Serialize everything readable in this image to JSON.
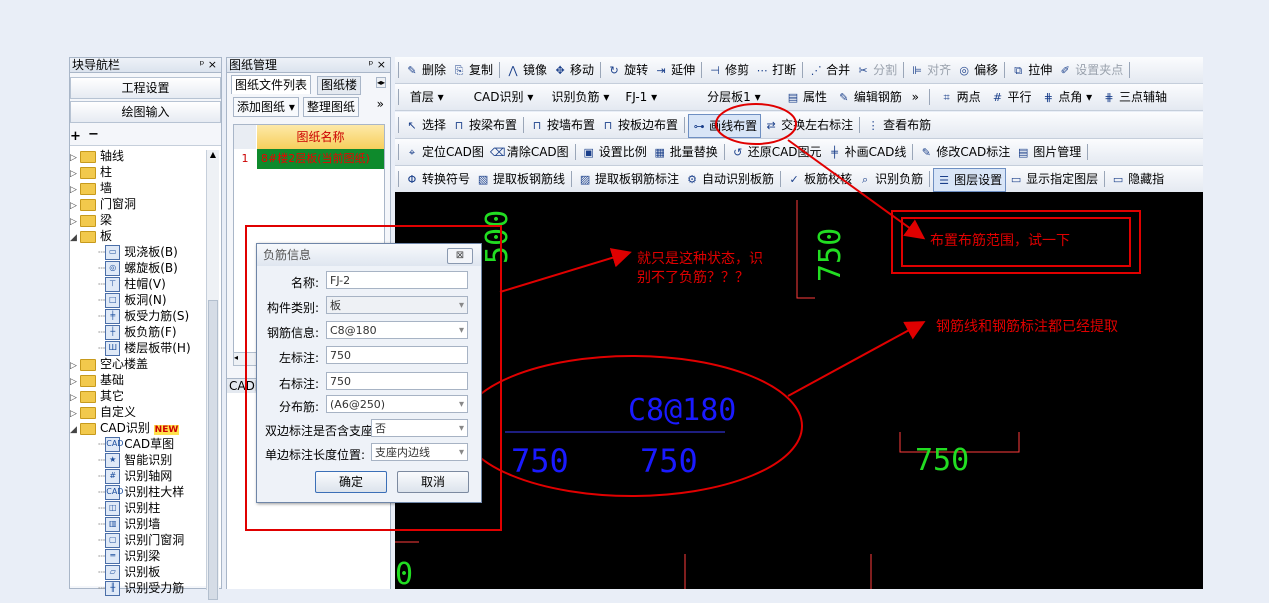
{
  "nav_panel": {
    "title": "块导航栏",
    "pin": "ᵖ",
    "close": "×",
    "buttons": [
      "工程设置",
      "绘图输入"
    ],
    "tree": [
      {
        "label": "轴线",
        "level": 0,
        "icon": "folder-icon"
      },
      {
        "label": "柱",
        "level": 0,
        "icon": "folder-icon"
      },
      {
        "label": "墙",
        "level": 0,
        "icon": "folder-icon"
      },
      {
        "label": "门窗洞",
        "level": 0,
        "icon": "folder-icon"
      },
      {
        "label": "梁",
        "level": 0,
        "icon": "folder-icon"
      },
      {
        "label": "板",
        "level": 0,
        "icon": "folder-open-icon"
      },
      {
        "label": "现浇板(B)",
        "level": 1,
        "icon": "slab-icon"
      },
      {
        "label": "螺旋板(B)",
        "level": 1,
        "icon": "spiral-slab-icon"
      },
      {
        "label": "柱帽(V)",
        "level": 1,
        "icon": "column-cap-icon"
      },
      {
        "label": "板洞(N)",
        "level": 1,
        "icon": "slab-hole-icon"
      },
      {
        "label": "板受力筋(S)",
        "level": 1,
        "icon": "slab-rebar-icon"
      },
      {
        "label": "板负筋(F)",
        "level": 1,
        "icon": "negative-rebar-icon"
      },
      {
        "label": "楼层板带(H)",
        "level": 1,
        "icon": "floor-strip-icon"
      },
      {
        "label": "空心楼盖",
        "level": 0,
        "icon": "folder-icon"
      },
      {
        "label": "基础",
        "level": 0,
        "icon": "folder-icon"
      },
      {
        "label": "其它",
        "level": 0,
        "icon": "folder-icon"
      },
      {
        "label": "自定义",
        "level": 0,
        "icon": "folder-icon"
      },
      {
        "label": "CAD识别",
        "level": 0,
        "icon": "folder-open-icon",
        "badge": "NEW"
      },
      {
        "label": "CAD草图",
        "level": 1,
        "icon": "cad-sketch-icon"
      },
      {
        "label": "智能识别",
        "level": 1,
        "icon": "smart-recognize-icon"
      },
      {
        "label": "识别轴网",
        "level": 1,
        "icon": "grid-recognize-icon"
      },
      {
        "label": "识别柱大样",
        "level": 1,
        "icon": "column-detail-icon"
      },
      {
        "label": "识别柱",
        "level": 1,
        "icon": "column-recognize-icon"
      },
      {
        "label": "识别墙",
        "level": 1,
        "icon": "wall-recognize-icon"
      },
      {
        "label": "识别门窗洞",
        "level": 1,
        "icon": "opening-recognize-icon"
      },
      {
        "label": "识别梁",
        "level": 1,
        "icon": "beam-recognize-icon"
      },
      {
        "label": "识别板",
        "level": 1,
        "icon": "slab-recognize-icon"
      },
      {
        "label": "识别受力筋",
        "level": 1,
        "icon": "rebar-recognize-icon"
      }
    ]
  },
  "drawing_panel": {
    "title": "图纸管理",
    "tabs": [
      "图纸文件列表",
      "图纸楼"
    ],
    "add_button": "添加图纸",
    "organize_button": "整理图纸",
    "more": "»",
    "column_header": "图纸名称",
    "rows": [
      {
        "index": "1",
        "name": "8#楼2层板(当前图纸)"
      }
    ],
    "cad_title": "CAD图"
  },
  "toolbar1": [
    {
      "label": "删除",
      "icon": "delete-icon"
    },
    {
      "label": "复制",
      "icon": "copy-icon"
    },
    {
      "label": "镜像",
      "icon": "mirror-icon"
    },
    {
      "label": "移动",
      "icon": "move-icon"
    },
    {
      "label": "旋转",
      "icon": "rotate-icon"
    },
    {
      "label": "延伸",
      "icon": "extend-icon"
    },
    {
      "label": "修剪",
      "icon": "trim-icon"
    },
    {
      "label": "打断",
      "icon": "break-icon"
    },
    {
      "label": "合并",
      "icon": "merge-icon"
    },
    {
      "label": "分割",
      "icon": "split-icon",
      "disabled": true
    },
    {
      "label": "对齐",
      "icon": "align-icon",
      "disabled": true
    },
    {
      "label": "偏移",
      "icon": "offset-icon"
    },
    {
      "label": "拉伸",
      "icon": "stretch-icon"
    },
    {
      "label": "设置夹点",
      "icon": "grip-icon",
      "disabled": true
    }
  ],
  "toolbar2": {
    "selects": [
      "首层",
      "CAD识别",
      "识别负筋",
      "FJ-1",
      "分层板1"
    ],
    "buttons": [
      "属性",
      "编辑钢筋"
    ],
    "more": "»",
    "right_buttons": [
      "两点",
      "平行",
      "点角",
      "三点辅轴"
    ]
  },
  "toolbar3": [
    {
      "label": "选择",
      "icon": "select-icon"
    },
    {
      "label": "按梁布置",
      "icon": "by-beam-icon"
    },
    {
      "label": "按墙布置",
      "icon": "by-wall-icon"
    },
    {
      "label": "按板边布置",
      "icon": "by-slab-edge-icon"
    },
    {
      "label": "画线布置",
      "icon": "draw-line-icon",
      "active": true
    },
    {
      "label": "交换左右标注",
      "icon": "swap-label-icon"
    },
    {
      "label": "查看布筋",
      "icon": "view-rebar-icon"
    }
  ],
  "toolbar4": [
    {
      "label": "定位CAD图",
      "icon": "locate-cad-icon"
    },
    {
      "label": "清除CAD图",
      "icon": "clear-cad-icon"
    },
    {
      "label": "设置比例",
      "icon": "scale-icon"
    },
    {
      "label": "批量替换",
      "icon": "batch-replace-icon"
    },
    {
      "label": "还原CAD图元",
      "icon": "restore-cad-icon"
    },
    {
      "label": "补画CAD线",
      "icon": "draw-cad-line-icon"
    },
    {
      "label": "修改CAD标注",
      "icon": "edit-cad-label-icon"
    },
    {
      "label": "图片管理",
      "icon": "image-manage-icon"
    }
  ],
  "toolbar5": [
    {
      "label": "转换符号",
      "icon": "convert-symbol-icon"
    },
    {
      "label": "提取板钢筋线",
      "icon": "extract-line-icon"
    },
    {
      "label": "提取板钢筋标注",
      "icon": "extract-label-icon"
    },
    {
      "label": "自动识别板筋",
      "icon": "auto-recognize-icon"
    },
    {
      "label": "板筋校核",
      "icon": "check-rebar-icon"
    },
    {
      "label": "识别负筋",
      "icon": "recognize-negative-icon"
    },
    {
      "label": "图层设置",
      "icon": "layer-settings-icon",
      "active": true
    },
    {
      "label": "显示指定图层",
      "icon": "show-layer-icon"
    },
    {
      "label": "隐藏指",
      "icon": "hide-layer-icon"
    }
  ],
  "canvas": {
    "texts": [
      {
        "id": "top-500",
        "text": "500"
      },
      {
        "id": "top-750",
        "text": "750"
      },
      {
        "id": "rebar-label",
        "text": "C8@180"
      },
      {
        "id": "left-750",
        "text": "750"
      },
      {
        "id": "mid-750",
        "text": "750"
      },
      {
        "id": "right-750",
        "text": "750"
      }
    ]
  },
  "dialog": {
    "title": "负筋信息",
    "close": "⊠",
    "fields": [
      {
        "label": "名称:",
        "value": "FJ-2",
        "readonly": false,
        "dropdown": false
      },
      {
        "label": "构件类别:",
        "value": "板",
        "readonly": true,
        "dropdown": true
      },
      {
        "label": "钢筋信息:",
        "value": "C8@180",
        "readonly": false,
        "dropdown": true
      },
      {
        "label": "左标注:",
        "value": "750",
        "readonly": false,
        "dropdown": false
      },
      {
        "label": "右标注:",
        "value": "750",
        "readonly": false,
        "dropdown": false
      },
      {
        "label": "分布筋:",
        "value": "(A6@250)",
        "readonly": false,
        "dropdown": true
      },
      {
        "label": "双边标注是否含支座:",
        "value": "否",
        "readonly": false,
        "dropdown": true
      },
      {
        "label": "单边标注长度位置:",
        "value": "支座内边线",
        "readonly": false,
        "dropdown": true
      }
    ],
    "ok": "确定",
    "cancel": "取消"
  },
  "annotations": {
    "state_note_line1": "就只是这种状态，识",
    "state_note_line2": "别不了负筋？？？",
    "range_note": "布置布筋范围，试一下",
    "extracted_note": "钢筋线和钢筋标注都已经提取"
  },
  "colors": {
    "annotation_red": "#e00000",
    "cad_green": "#22dd22",
    "cad_blue": "#1a1aff",
    "canvas_bg": "#000000"
  }
}
